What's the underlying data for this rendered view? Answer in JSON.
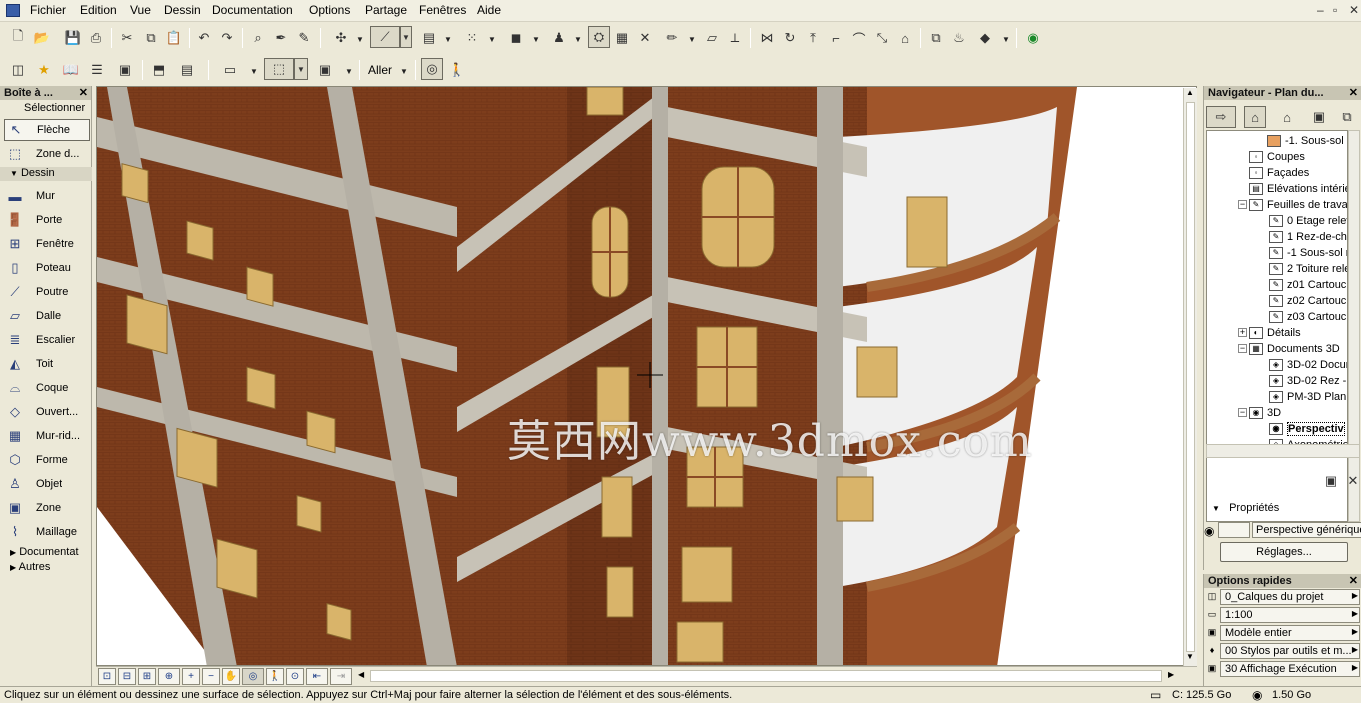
{
  "menu": [
    "Fichier",
    "Edition",
    "Vue",
    "Dessin",
    "Documentation",
    "Options",
    "Partage",
    "Fenêtres",
    "Aide"
  ],
  "toolbar2": {
    "goto_label": "Aller"
  },
  "toolbox": {
    "title": "Boîte à ...",
    "select_header": "Sélectionner",
    "select_tools": [
      "Flèche",
      "Zone d..."
    ],
    "design_group": "Dessin",
    "tools": [
      "Mur",
      "Porte",
      "Fenêtre",
      "Poteau",
      "Poutre",
      "Dalle",
      "Escalier",
      "Toit",
      "Coque",
      "Ouvert...",
      "Mur-rid...",
      "Forme",
      "Objet",
      "Zone",
      "Maillage"
    ],
    "groups": [
      "Documentat",
      "Autres"
    ]
  },
  "navigator": {
    "title": "Navigateur - Plan du...",
    "tree": [
      {
        "label": "-1. Sous-sol",
        "level": 3
      },
      {
        "label": "Coupes",
        "level": 1
      },
      {
        "label": "Façades",
        "level": 1
      },
      {
        "label": "Elévations intérie",
        "level": 1
      },
      {
        "label": "Feuilles de trava",
        "level": 1
      },
      {
        "label": "0 Etage relev",
        "level": 2
      },
      {
        "label": "1 Rez-de-cha",
        "level": 2
      },
      {
        "label": "-1 Sous-sol r",
        "level": 2
      },
      {
        "label": "2 Toiture rele",
        "level": 2
      },
      {
        "label": "z01 Cartouch",
        "level": 2
      },
      {
        "label": "z02 Cartouch",
        "level": 2
      },
      {
        "label": "z03 Cartouch",
        "level": 2
      },
      {
        "label": "Détails",
        "level": 1
      },
      {
        "label": "Documents 3D",
        "level": 1
      },
      {
        "label": "3D-02 Docum",
        "level": 2
      },
      {
        "label": "3D-02 Rez -",
        "level": 2
      },
      {
        "label": "PM-3D Plan N",
        "level": 2
      },
      {
        "label": "3D",
        "level": 1
      },
      {
        "label": "Perspectiv",
        "level": 2
      },
      {
        "label": "Axonométrie",
        "level": 2
      }
    ],
    "properties_label": "Propriétés",
    "properties_value": "Perspective générique",
    "settings_button": "Réglages..."
  },
  "quick_options": {
    "title": "Options rapides",
    "rows": [
      "0_Calques du projet",
      "1:100",
      "Modèle entier",
      "00 Stylos par outils et m...",
      "30 Affichage Exécution"
    ]
  },
  "viewport": {
    "watermark": "莫西网www.3dmox.com"
  },
  "status": {
    "message": "Cliquez sur un élément ou dessinez une surface de sélection. Appuyez sur Ctrl+Maj pour faire alterner la sélection de l'élément et des sous-éléments.",
    "disk": "C: 125.5 Go",
    "memory": "1.50 Go"
  },
  "colors": {
    "brick": "#7a3a1a",
    "stone": "#b8b3a8",
    "window_frame": "#d9b46a"
  }
}
